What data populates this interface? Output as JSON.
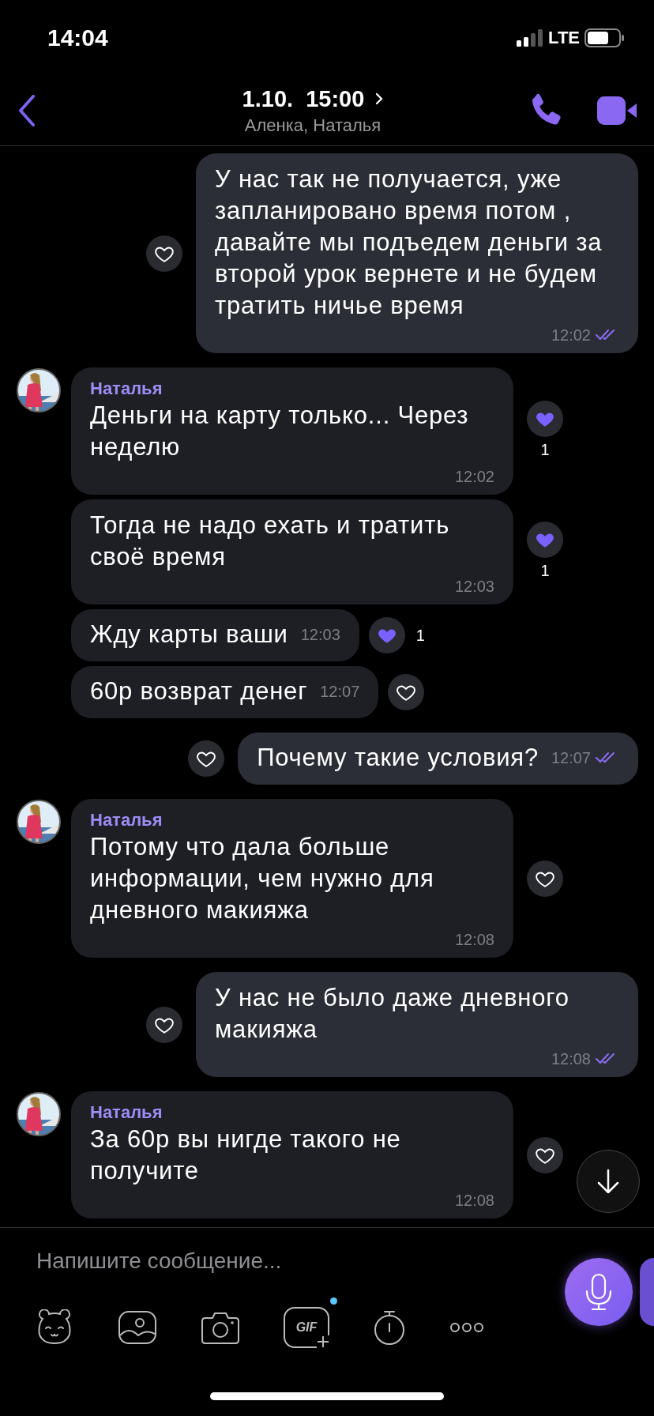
{
  "status_bar": {
    "time": "14:04",
    "network": "LTE"
  },
  "header": {
    "title": "1.10.  15:00",
    "subtitle": "Аленка, Наталья"
  },
  "messages": [
    {
      "kind": "outgoing",
      "text": "У нас так не получается, уже запланировано время потом , давайте мы подъедем деньги за второй урок вернете и не будем тратить ничье время",
      "time": "12:02",
      "read": true,
      "reaction": {
        "liked": false
      }
    },
    {
      "kind": "incoming",
      "sender": "Наталья",
      "avatar": true,
      "text": "Деньги на карту только... Через неделю",
      "time": "12:02",
      "reaction": {
        "liked": true,
        "count": "1"
      }
    },
    {
      "kind": "incoming",
      "avatar": false,
      "text": "Тогда не надо ехать и тратить своё время",
      "time": "12:03",
      "reaction": {
        "liked": true,
        "count": "1"
      }
    },
    {
      "kind": "incoming",
      "avatar": false,
      "text": "Жду карты ваши",
      "time": "12:03",
      "reaction": {
        "liked": true,
        "count": "1"
      }
    },
    {
      "kind": "incoming",
      "avatar": false,
      "text": "60р возврат денег",
      "time": "12:07",
      "reaction": {
        "liked": false
      }
    },
    {
      "kind": "outgoing",
      "text": "Почему такие условия?",
      "time": "12:07",
      "read": true,
      "reaction": {
        "liked": false
      }
    },
    {
      "kind": "incoming",
      "sender": "Наталья",
      "avatar": true,
      "text": "Потому что дала больше информации, чем нужно для дневного макияжа",
      "time": "12:08",
      "reaction": {
        "liked": false
      }
    },
    {
      "kind": "outgoing",
      "text": "У нас не было даже дневного макияжа",
      "time": "12:08",
      "read": true,
      "reaction": {
        "liked": false
      }
    },
    {
      "kind": "incoming",
      "sender": "Наталья",
      "avatar": true,
      "text": "За 60р вы нигде такого не получите",
      "time": "12:08",
      "reaction": {
        "liked": false
      }
    }
  ],
  "composer": {
    "placeholder": "Напишите сообщение...",
    "gif_label": "GIF",
    "gif_new": true
  }
}
